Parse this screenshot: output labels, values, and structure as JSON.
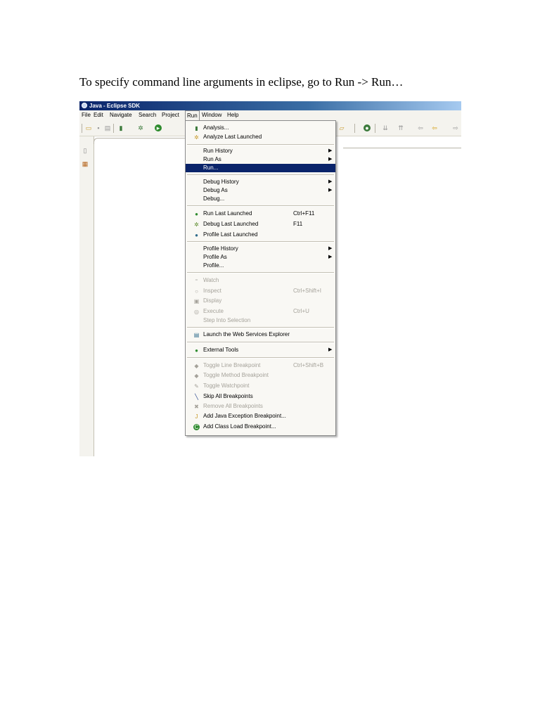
{
  "caption": "To specify command line arguments in eclipse, go to Run -> Run…",
  "window": {
    "title": "Java - Eclipse SDK"
  },
  "menubar": [
    "File",
    "Edit",
    "Navigate",
    "Search",
    "Project",
    "Run",
    "Window",
    "Help"
  ],
  "run_menu": {
    "items": [
      {
        "label": "Analysis...",
        "icon": "analysis-icon"
      },
      {
        "label": "Analyze Last Launched",
        "icon": "analyze-icon"
      },
      {
        "label": "Run History",
        "submenu": true
      },
      {
        "label": "Run As",
        "submenu": true
      },
      {
        "label": "Run...",
        "selected": true
      },
      {
        "label": "Debug History",
        "submenu": true
      },
      {
        "label": "Debug As",
        "submenu": true
      },
      {
        "label": "Debug..."
      },
      {
        "label": "Run Last Launched",
        "shortcut": "Ctrl+F11",
        "icon": "run-icon"
      },
      {
        "label": "Debug Last Launched",
        "shortcut": "F11",
        "icon": "debug-icon"
      },
      {
        "label": "Profile Last Launched",
        "icon": "profile-icon"
      },
      {
        "label": "Profile History",
        "submenu": true
      },
      {
        "label": "Profile As",
        "submenu": true
      },
      {
        "label": "Profile..."
      },
      {
        "label": "Watch",
        "disabled": true,
        "icon": "watch-icon"
      },
      {
        "label": "Inspect",
        "shortcut": "Ctrl+Shift+I",
        "disabled": true,
        "icon": "inspect-icon"
      },
      {
        "label": "Display",
        "disabled": true,
        "icon": "display-icon"
      },
      {
        "label": "Execute",
        "shortcut": "Ctrl+U",
        "disabled": true,
        "icon": "execute-icon"
      },
      {
        "label": "Step Into Selection",
        "disabled": true
      },
      {
        "label": "Launch the Web Services Explorer",
        "icon": "web-services-icon"
      },
      {
        "label": "External Tools",
        "submenu": true,
        "icon": "external-tools-icon"
      },
      {
        "label": "Toggle Line Breakpoint",
        "shortcut": "Ctrl+Shift+B",
        "disabled": true,
        "icon": "line-breakpoint-icon"
      },
      {
        "label": "Toggle Method Breakpoint",
        "disabled": true,
        "icon": "method-breakpoint-icon"
      },
      {
        "label": "Toggle Watchpoint",
        "disabled": true,
        "icon": "watchpoint-icon"
      },
      {
        "label": "Skip All Breakpoints",
        "icon": "skip-breakpoints-icon"
      },
      {
        "label": "Remove All Breakpoints",
        "disabled": true,
        "icon": "remove-breakpoints-icon"
      },
      {
        "label": "Add Java Exception Breakpoint...",
        "icon": "exception-breakpoint-icon"
      },
      {
        "label": "Add Class Load Breakpoint...",
        "icon": "class-load-breakpoint-icon"
      }
    ]
  }
}
